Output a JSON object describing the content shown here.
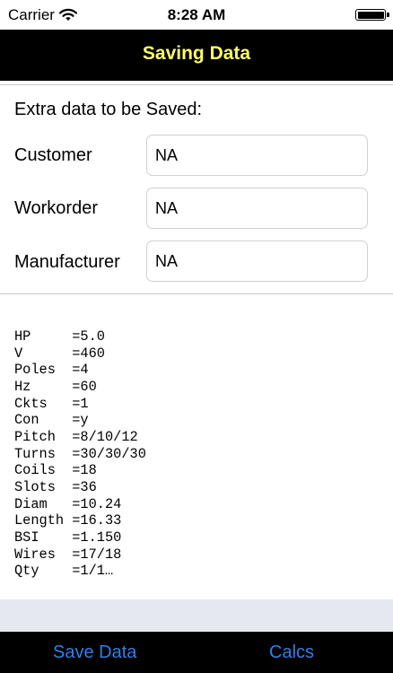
{
  "status_bar": {
    "carrier": "Carrier",
    "time": "8:28 AM",
    "wifi_icon": "wifi-icon",
    "battery_icon": "battery-icon"
  },
  "nav": {
    "title": "Saving Data",
    "title_color": "#ffff66"
  },
  "form": {
    "heading": "Extra data to be Saved:",
    "rows": [
      {
        "label": "Customer",
        "value": "NA"
      },
      {
        "label": "Workorder",
        "value": "NA"
      },
      {
        "label": "Manufacturer",
        "value": "NA"
      }
    ]
  },
  "data_text": "HP     =5.0\nV      =460\nPoles  =4\nHz     =60\nCkts   =1\nCon    =y\nPitch  =8/10/12\nTurns  =30/30/30\nCoils  =18\nSlots  =36\nDiam   =10.24\nLength =16.33\nBSI    =1.150\nWires  =17/18\nQty    =1/1…",
  "toolbar": {
    "save_label": "Save Data",
    "calcs_label": "Calcs",
    "button_color": "#2f7fe8"
  }
}
